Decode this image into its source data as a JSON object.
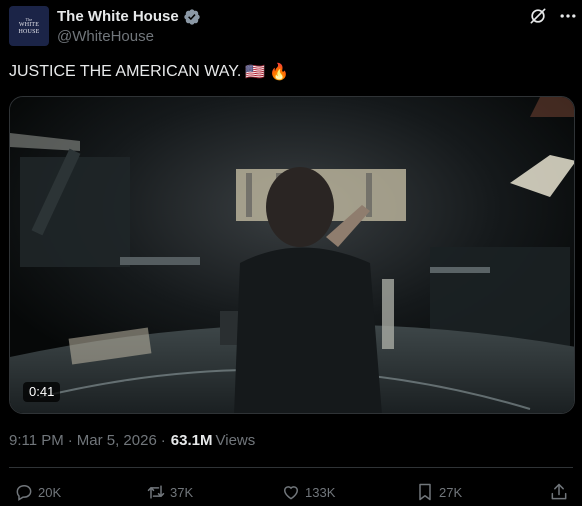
{
  "author": {
    "display_name": "The White House",
    "handle": "@WhiteHouse",
    "avatar_text_lines": [
      "The",
      "WHITE",
      "HOUSE"
    ],
    "verified_color": "#8b98a5"
  },
  "tweet": {
    "text": "JUSTICE THE AMERICAN WAY.",
    "emojis": [
      "🇺🇸",
      "🔥"
    ]
  },
  "video": {
    "duration": "0:41"
  },
  "meta": {
    "time": "9:11 PM",
    "separator": "·",
    "date": "Mar 5, 2026",
    "views_count": "63.1M",
    "views_label": "Views"
  },
  "actions": {
    "replies": "20K",
    "reposts": "37K",
    "likes": "133K",
    "bookmarks": "27K"
  },
  "icons": {
    "grok": "grok-icon",
    "more": "more-icon",
    "reply": "reply-icon",
    "repost": "repost-icon",
    "like": "heart-icon",
    "bookmark": "bookmark-icon",
    "share": "share-icon"
  },
  "colors": {
    "background": "#000000",
    "text": "#e7e9ea",
    "secondary": "#71767b",
    "border": "#2f3336"
  }
}
